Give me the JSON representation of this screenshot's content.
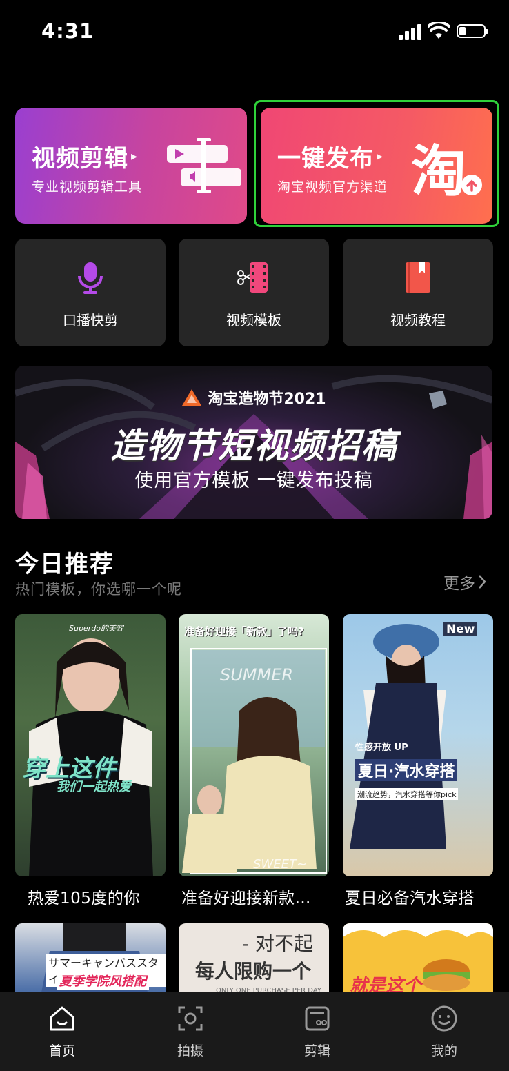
{
  "status_bar": {
    "time": "4:31"
  },
  "cards": {
    "edit": {
      "title": "视频剪辑",
      "subtitle": "专业视频剪辑工具"
    },
    "publish": {
      "title": "一键发布",
      "subtitle": "淘宝视频官方渠道",
      "logo_text": "淘"
    }
  },
  "tools": [
    {
      "label": "口播快剪",
      "icon": "microphone-icon"
    },
    {
      "label": "视频模板",
      "icon": "film-scissors-icon"
    },
    {
      "label": "视频教程",
      "icon": "book-icon"
    }
  ],
  "banner": {
    "brand": "淘宝造物节2021",
    "title": "造物节短视频招稿",
    "subtitle": "使用官方模板 一键发布投稿"
  },
  "recommend": {
    "title": "今日推荐",
    "subtitle": "热门模板，你选哪一个呢",
    "more_label": "更多",
    "items": [
      {
        "caption": "热爱105度的你",
        "overlay_top": "Superdo的美容",
        "overlay_main": "穿上这件",
        "overlay_sub": "我们一起热爱"
      },
      {
        "caption": "准备好迎接新款…",
        "overlay_top": "准备好迎接「新款」了吗?",
        "overlay_main": "SUMMER",
        "overlay_sub": "SWEET~"
      },
      {
        "caption": "夏日必备汽水穿搭",
        "overlay_top": "New",
        "overlay_main": "夏日·汽水穿搭",
        "overlay_sub": "潮流趋势，汽水穿搭等你pick",
        "overlay_small": "性感开放 UP"
      }
    ],
    "row2": [
      {
        "text1": "サマーキャンバススタイル",
        "text2": "夏季学院风搭配"
      },
      {
        "text1": "- 对不起",
        "text2": "每人限购一个",
        "text3": "ONLY ONE PURCHASE PER DAY"
      },
      {
        "text1": "就是这个"
      }
    ]
  },
  "nav": [
    {
      "label": "首页",
      "icon": "home-icon"
    },
    {
      "label": "拍摄",
      "icon": "camera-icon"
    },
    {
      "label": "剪辑",
      "icon": "edit-icon"
    },
    {
      "label": "我的",
      "icon": "profile-icon"
    }
  ]
}
